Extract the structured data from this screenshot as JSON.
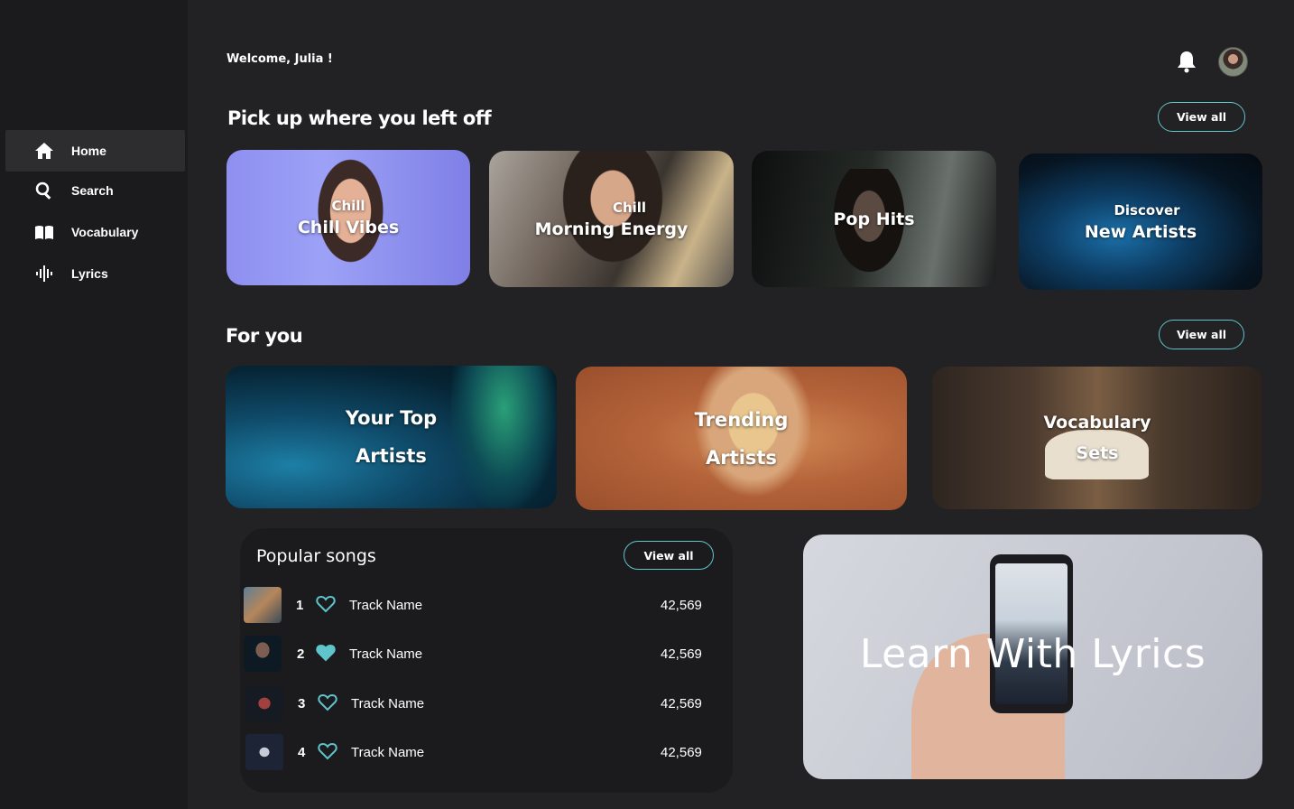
{
  "sidebar": {
    "items": [
      {
        "label": "Home",
        "icon": "home-icon",
        "active": true
      },
      {
        "label": "Search",
        "icon": "search-icon",
        "active": false
      },
      {
        "label": "Vocabulary",
        "icon": "book-icon",
        "active": false
      },
      {
        "label": "Lyrics",
        "icon": "waveform-icon",
        "active": false
      }
    ]
  },
  "header": {
    "welcome": "Welcome, Julia !",
    "bell_icon": "bell-icon",
    "avatar_icon": "user-avatar"
  },
  "pickup": {
    "title": "Pick up where you left off",
    "view_all": "View all",
    "cards": [
      {
        "kicker": "Chill",
        "title": "Chill Vibes"
      },
      {
        "kicker": "Chill",
        "title": "Morning Energy"
      },
      {
        "kicker": "",
        "title": "Pop Hits"
      },
      {
        "kicker": "Discover",
        "title": "New Artists"
      }
    ]
  },
  "for_you": {
    "title": "For you",
    "view_all": "View all",
    "cards": [
      {
        "line1": "Your Top",
        "line2": "Artists"
      },
      {
        "line1": "Trending",
        "line2": "Artists"
      },
      {
        "line1": "Vocabulary",
        "line2": "Sets"
      }
    ]
  },
  "popular": {
    "title": "Popular songs",
    "view_all": "View all",
    "tracks": [
      {
        "rank": "1",
        "name": "Track Name",
        "plays": "42,569",
        "liked": false
      },
      {
        "rank": "2",
        "name": "Track Name",
        "plays": "42,569",
        "liked": true
      },
      {
        "rank": "3",
        "name": "Track Name",
        "plays": "42,569",
        "liked": false
      },
      {
        "rank": "4",
        "name": "Track Name",
        "plays": "42,569",
        "liked": false
      }
    ]
  },
  "lyrics_promo": {
    "title": "Learn With Lyrics"
  },
  "colors": {
    "accent": "#5fc4cc",
    "background": "#222224",
    "sidebar": "#1b1b1d"
  }
}
